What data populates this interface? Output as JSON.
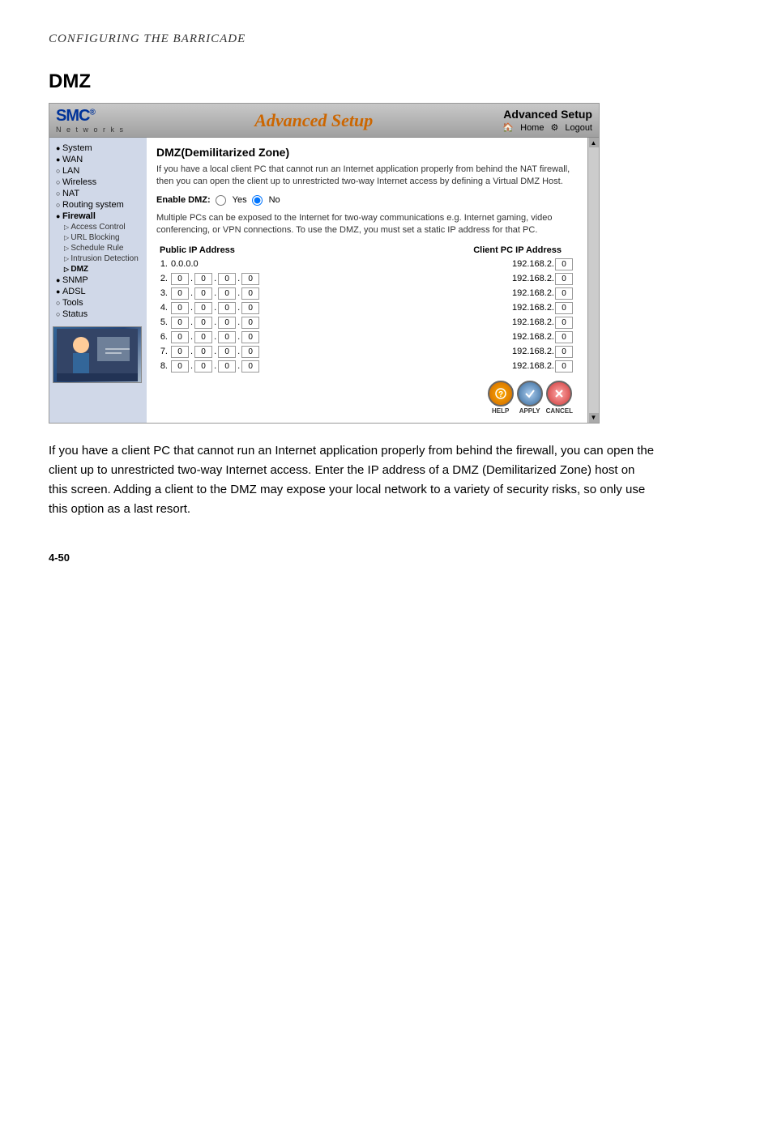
{
  "page": {
    "header": "Configuring the Barricade",
    "section_title": "DMZ",
    "footer": "4-50"
  },
  "router": {
    "brand": "SMC",
    "brand_sup": "®",
    "networks": "N e t w o r k s",
    "advanced_setup": "Advanced Setup",
    "nav": {
      "home": "Home",
      "logout": "Logout"
    },
    "header_title": "Advanced Setup"
  },
  "sidebar": {
    "items": [
      {
        "id": "system",
        "label": "System",
        "type": "filled"
      },
      {
        "id": "wan",
        "label": "WAN",
        "type": "filled"
      },
      {
        "id": "lan",
        "label": "LAN",
        "type": "bullet"
      },
      {
        "id": "wireless",
        "label": "Wireless",
        "type": "bullet"
      },
      {
        "id": "nat",
        "label": "NAT",
        "type": "bullet"
      },
      {
        "id": "routing",
        "label": "Routing system",
        "type": "bullet"
      },
      {
        "id": "firewall",
        "label": "Firewall",
        "type": "filled",
        "active": true
      },
      {
        "id": "snmp",
        "label": "SNMP",
        "type": "filled"
      },
      {
        "id": "adsl",
        "label": "ADSL",
        "type": "filled"
      },
      {
        "id": "tools",
        "label": "Tools",
        "type": "bullet"
      },
      {
        "id": "status",
        "label": "Status",
        "type": "bullet"
      }
    ],
    "firewall_sub": [
      {
        "id": "access-control",
        "label": "Access Control"
      },
      {
        "id": "url-blocking",
        "label": "URL Blocking"
      },
      {
        "id": "schedule-rule",
        "label": "Schedule Rule"
      },
      {
        "id": "intrusion-detection",
        "label": "Intrusion Detection"
      },
      {
        "id": "dmz",
        "label": "DMZ",
        "active": true
      }
    ]
  },
  "main": {
    "title": "DMZ(Demilitarized Zone)",
    "description1": "If you have a local client PC that cannot run an Internet application properly from behind the NAT firewall, then you can open the client up to unrestricted two-way Internet access by defining a Virtual DMZ Host.",
    "enable_label": "Enable DMZ:",
    "radio_yes": "Yes",
    "radio_no": "No",
    "radio_no_selected": true,
    "description2": "Multiple PCs can be exposed to the Internet for two-way communications e.g. Internet gaming, video conferencing, or VPN connections.  To use the DMZ, you must set a static IP address for that PC.",
    "col_public": "Public IP Address",
    "col_client": "Client PC IP Address",
    "rows": [
      {
        "num": "1",
        "static": true,
        "public": "0.0.0.0",
        "client_prefix": "192.168.2.",
        "client_last": "0"
      },
      {
        "num": "2",
        "octets": [
          "0",
          "0",
          "0",
          "0"
        ],
        "client_prefix": "192.168.2.",
        "client_last": "0"
      },
      {
        "num": "3",
        "octets": [
          "0",
          "0",
          "0",
          "0"
        ],
        "client_prefix": "192.168.2.",
        "client_last": "0"
      },
      {
        "num": "4",
        "octets": [
          "0",
          "0",
          "0",
          "0"
        ],
        "client_prefix": "192.168.2.",
        "client_last": "0"
      },
      {
        "num": "5",
        "octets": [
          "0",
          "0",
          "0",
          "0"
        ],
        "client_prefix": "192.168.2.",
        "client_last": "0"
      },
      {
        "num": "6",
        "octets": [
          "0",
          "0",
          "0",
          "0"
        ],
        "client_prefix": "192.168.2.",
        "client_last": "0"
      },
      {
        "num": "7",
        "octets": [
          "0",
          "0",
          "0",
          "0"
        ],
        "client_prefix": "192.168.2.",
        "client_last": "0"
      },
      {
        "num": "8",
        "octets": [
          "0",
          "0",
          "0",
          "0"
        ],
        "client_prefix": "192.168.2.",
        "client_last": "0"
      }
    ],
    "buttons": {
      "help": "HELP",
      "apply": "APPLY",
      "cancel": "CANCEL"
    }
  },
  "body_text": "If you have a client PC that cannot run an Internet application properly from behind the firewall, you can open the client up to unrestricted two-way Internet access. Enter the IP address of a DMZ (Demilitarized Zone) host on this screen. Adding a client to the DMZ may expose your local network to a variety of security risks, so only use this option as a last resort."
}
